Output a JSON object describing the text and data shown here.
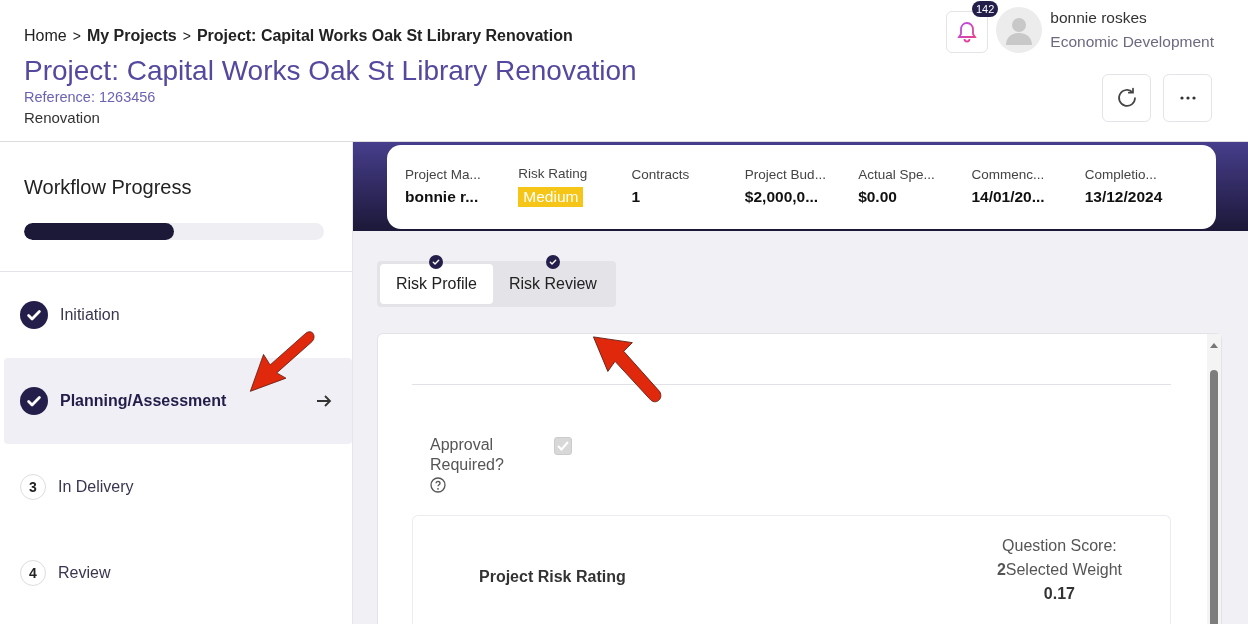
{
  "breadcrumb": [
    {
      "label": "Home",
      "bold": false
    },
    {
      "label": "My Projects",
      "bold": true
    },
    {
      "label": "Project: Capital Works Oak St Library Renovation",
      "bold": true
    }
  ],
  "breadcrumb_separator": ">",
  "title": "Project: Capital Works Oak St Library Renovation",
  "reference": "Reference: 1263456",
  "category": "Renovation",
  "notifications": {
    "count": "142"
  },
  "user": {
    "name": "bonnie roskes",
    "department": "Economic Development"
  },
  "workflow": {
    "title": "Workflow Progress",
    "level": 0.5
  },
  "steps": [
    {
      "label": "Initiation",
      "kind": "done",
      "selected": false
    },
    {
      "label": "Planning/Assessment",
      "kind": "done",
      "selected": true
    },
    {
      "label": "In Delivery",
      "kind": "number",
      "number": "3",
      "selected": false
    },
    {
      "label": "Review",
      "kind": "number",
      "number": "4",
      "selected": false
    }
  ],
  "summary": [
    {
      "label": "Project Ma...",
      "value": "bonnie r...",
      "kind": "text"
    },
    {
      "label": "Risk Rating",
      "value": "Medium",
      "kind": "badge"
    },
    {
      "label": "Contracts",
      "value": "1",
      "kind": "text"
    },
    {
      "label": "Project Bud...",
      "value": "$2,000,0...",
      "kind": "text"
    },
    {
      "label": "Actual Spe...",
      "value": "$0.00",
      "kind": "text"
    },
    {
      "label": "Commenc...",
      "value": "14/01/20...",
      "kind": "text"
    },
    {
      "label": "Completio...",
      "value": "13/12/2024",
      "kind": "text"
    }
  ],
  "tabs": [
    {
      "label": "Risk Profile",
      "selected": true,
      "completed": true
    },
    {
      "label": "Risk Review",
      "selected": false,
      "completed": true
    }
  ],
  "approval": {
    "label": "Approval Required?",
    "checked": true,
    "disabled": true
  },
  "question": {
    "title": "Project Risk Rating",
    "score_label": "Question Score:",
    "score": "2",
    "weight_label": "Selected Weight",
    "weight": "0.17"
  }
}
